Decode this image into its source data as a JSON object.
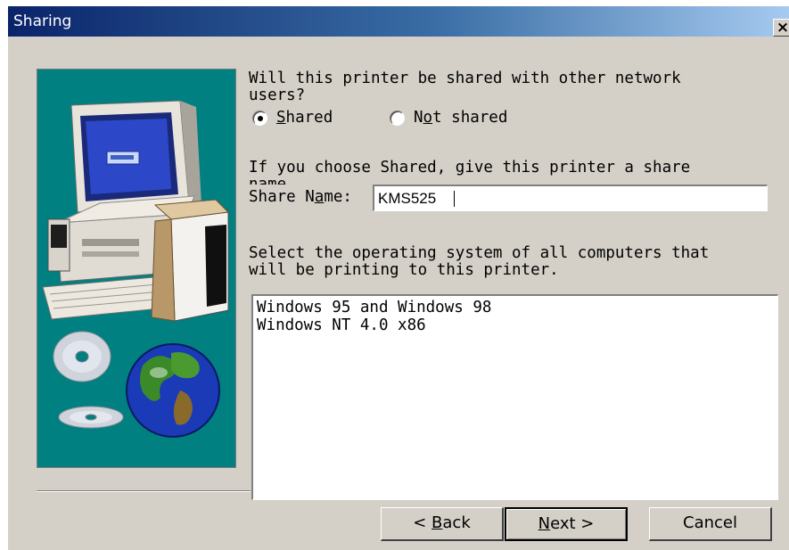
{
  "window": {
    "title": "Sharing",
    "close_label": "×"
  },
  "question": {
    "line1": "Will this printer be shared with other network",
    "line2": "users?"
  },
  "sharing_options": {
    "shared_pre": "",
    "shared_key": "S",
    "shared_post": "hared",
    "not_shared_pre": "N",
    "not_shared_key": "o",
    "not_shared_post": "t shared",
    "selected": "Shared"
  },
  "share_name": {
    "instruction_line1": "If you choose Shared, give this printer a share",
    "instruction_line2": "name.",
    "label_pre": "Share N",
    "label_key": "a",
    "label_post": "me:",
    "value": "KMS525"
  },
  "os_selection": {
    "instruction_line1": "Select the operating system of all computers that",
    "instruction_line2": "will be printing to this printer.",
    "items": [
      "Windows 95 and Windows 98",
      "Windows NT 4.0 x86"
    ]
  },
  "buttons": {
    "back_pre": "< ",
    "back_key": "B",
    "back_post": "ack",
    "next_key": "N",
    "next_post": "ext >",
    "cancel": "Cancel"
  },
  "colors": {
    "panel_bg": "#008080",
    "dialog_bg": "#d4d0c8",
    "titlebar_start": "#0a246a"
  },
  "icons": [
    "computer-illustration",
    "globe-icon",
    "cd-disc-icon"
  ]
}
